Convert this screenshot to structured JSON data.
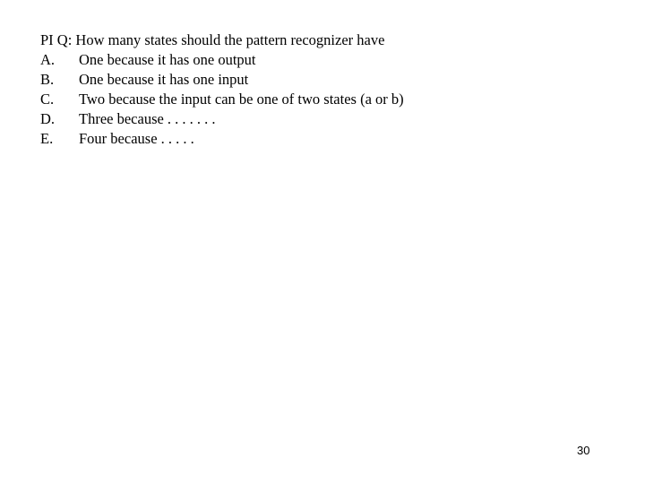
{
  "slide": {
    "background_color": "#ffffff",
    "text_color": "#000000",
    "page_number": "30"
  },
  "question": {
    "stem": "PI Q: How many states should the pattern recognizer have",
    "choices": [
      {
        "label": "A.",
        "text": "One because it has one output"
      },
      {
        "label": "B.",
        "text": "One because it has one input"
      },
      {
        "label": "C.",
        "text": "Two because the input can be one of two states (a or b)"
      },
      {
        "label": "D.",
        "text": "Three because . . . . . . ."
      },
      {
        "label": "E.",
        "text": "Four because . . . . ."
      }
    ]
  }
}
